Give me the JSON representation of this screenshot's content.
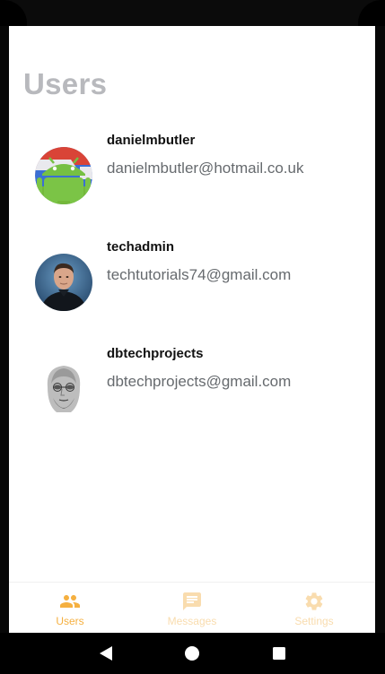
{
  "page": {
    "title": "Users"
  },
  "users": [
    {
      "username": "danielmbutler",
      "email": "danielmbutler@hotmail.co.uk",
      "avatar": "android-robot-avatar"
    },
    {
      "username": "techadmin",
      "email": "techtutorials74@gmail.com",
      "avatar": "man-in-black-shirt-avatar"
    },
    {
      "username": "dbtechprojects",
      "email": "dbtechprojects@gmail.com",
      "avatar": "grayscale-portrait-avatar"
    }
  ],
  "bottom_nav": {
    "items": [
      {
        "label": "Users",
        "icon": "people-icon",
        "active": true
      },
      {
        "label": "Messages",
        "icon": "message-icon",
        "active": false
      },
      {
        "label": "Settings",
        "icon": "gear-icon",
        "active": false
      }
    ]
  },
  "colors": {
    "accent": "#f5b040",
    "accent_inactive": "#f9dcae",
    "title": "#b8b9bd",
    "email": "#666a6e"
  },
  "system_nav": {
    "buttons": [
      "back-icon",
      "home-icon",
      "recents-icon"
    ]
  }
}
